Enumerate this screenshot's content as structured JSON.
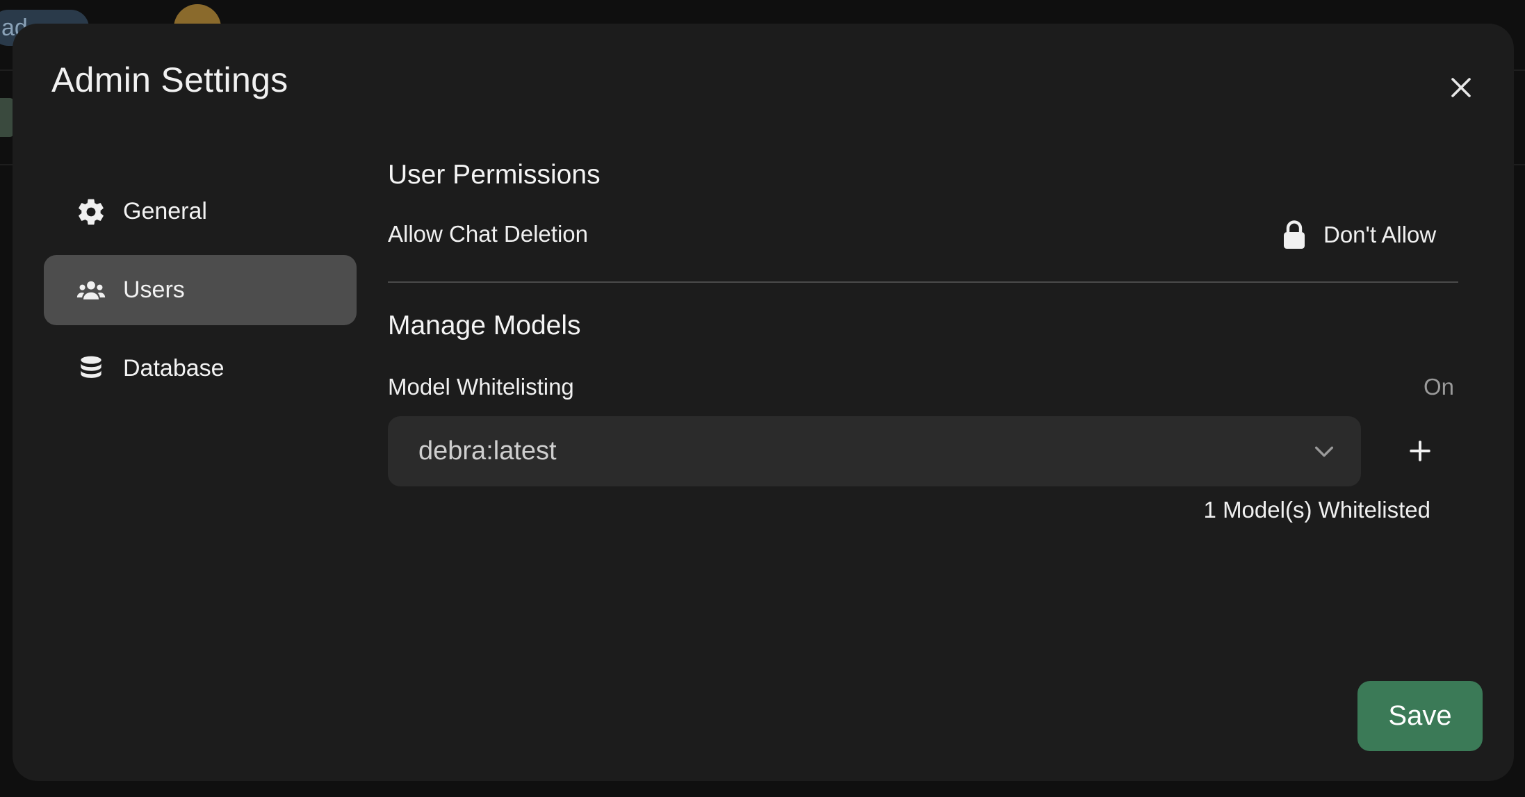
{
  "background": {
    "badge_fragment": "ad"
  },
  "modal": {
    "title": "Admin Settings",
    "close_icon": "close-icon"
  },
  "sidebar": {
    "items": [
      {
        "label": "General",
        "icon": "gear-icon",
        "active": false
      },
      {
        "label": "Users",
        "icon": "users-icon",
        "active": true
      },
      {
        "label": "Database",
        "icon": "database-icon",
        "active": false
      }
    ]
  },
  "permissions": {
    "title": "User Permissions",
    "chat_deletion_label": "Allow Chat Deletion",
    "chat_deletion_value": "Don't Allow",
    "chat_deletion_icon": "lock-icon"
  },
  "models": {
    "title": "Manage Models",
    "whitelisting_label": "Model Whitelisting",
    "whitelisting_value": "On",
    "selected_model": "debra:latest",
    "add_icon": "plus-icon",
    "count_text": "1 Model(s) Whitelisted"
  },
  "footer": {
    "save_label": "Save"
  },
  "colors": {
    "modal_bg": "#1c1c1c",
    "active_item_bg": "#4d4d4d",
    "select_bg": "#2b2b2b",
    "save_bg": "#3b7a57"
  }
}
